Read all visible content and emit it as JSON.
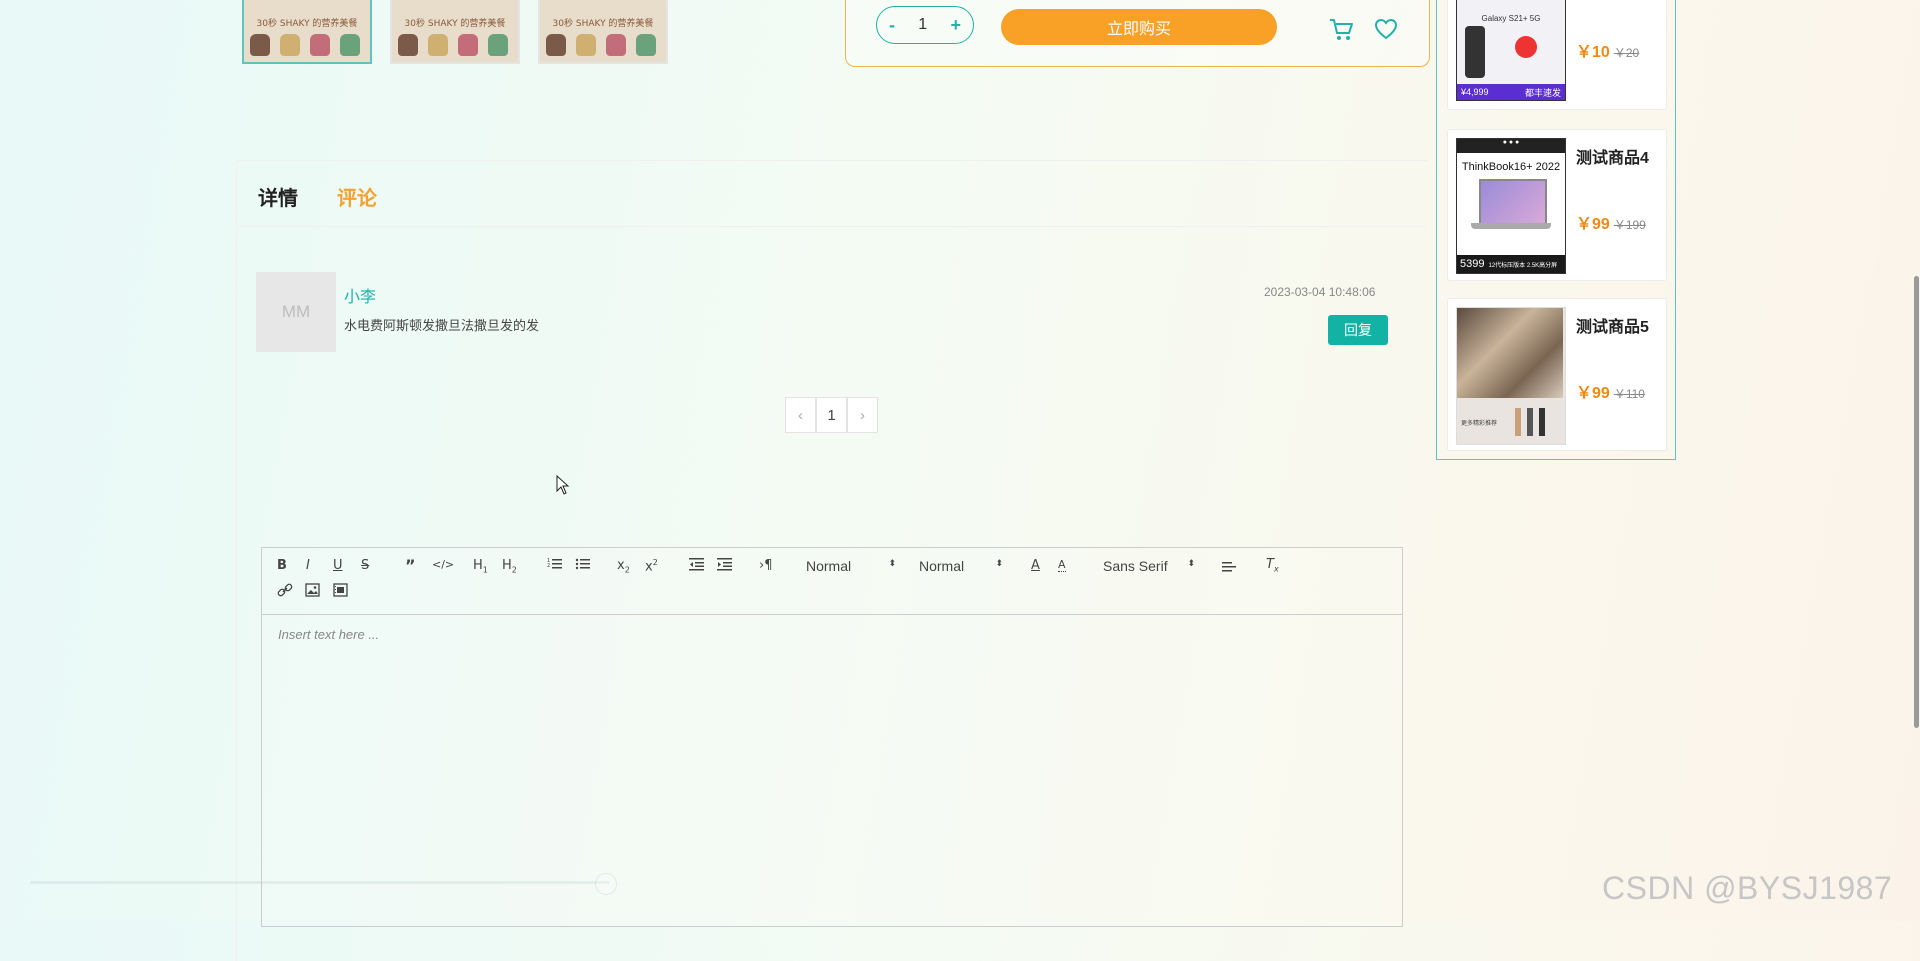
{
  "thumbnails": [
    {
      "banner": "30秒 SHAKY 的营养美餐"
    },
    {
      "banner": "30秒 SHAKY 的营养美餐"
    },
    {
      "banner": "30秒 SHAKY 的营养美餐"
    }
  ],
  "buy": {
    "minus": "-",
    "qty": "1",
    "plus": "+",
    "buy_label": "立即购买"
  },
  "tabs": {
    "details": "详情",
    "comments": "评论"
  },
  "comment": {
    "avatar": "MM",
    "user": "小李",
    "text": "水电费阿斯顿发撒旦法撒旦发的发",
    "time": "2023-03-04 10:48:06",
    "reply": "回复"
  },
  "pagination": {
    "prev": "‹",
    "page": "1",
    "next": "›"
  },
  "editor": {
    "header_select": "Normal",
    "size_select": "Normal",
    "font_select": "Sans Serif",
    "placeholder": "Insert text here ..."
  },
  "sidebar": {
    "items": [
      {
        "name": "",
        "price": "￥10",
        "original": "￥20",
        "img_text_top": "Galaxy S21+ 5G",
        "img_price": "¥4,999",
        "img_tag": "都丰速发"
      },
      {
        "name": "测试商品4",
        "price": "￥99",
        "original": "￥199",
        "img_text_top": "ThinkBook16+ 2022",
        "img_price": "5399",
        "img_tag": "12代标压版本 2.5K高分屏"
      },
      {
        "name": "测试商品5",
        "price": "￥99",
        "original": "￥110",
        "img_text_top": "更多精彩推荐"
      }
    ]
  },
  "watermark": "CSDN @BYSJ1987",
  "colors": {
    "accent": "#20b2aa",
    "orange": "#f8a126",
    "price": "#f08a14"
  }
}
